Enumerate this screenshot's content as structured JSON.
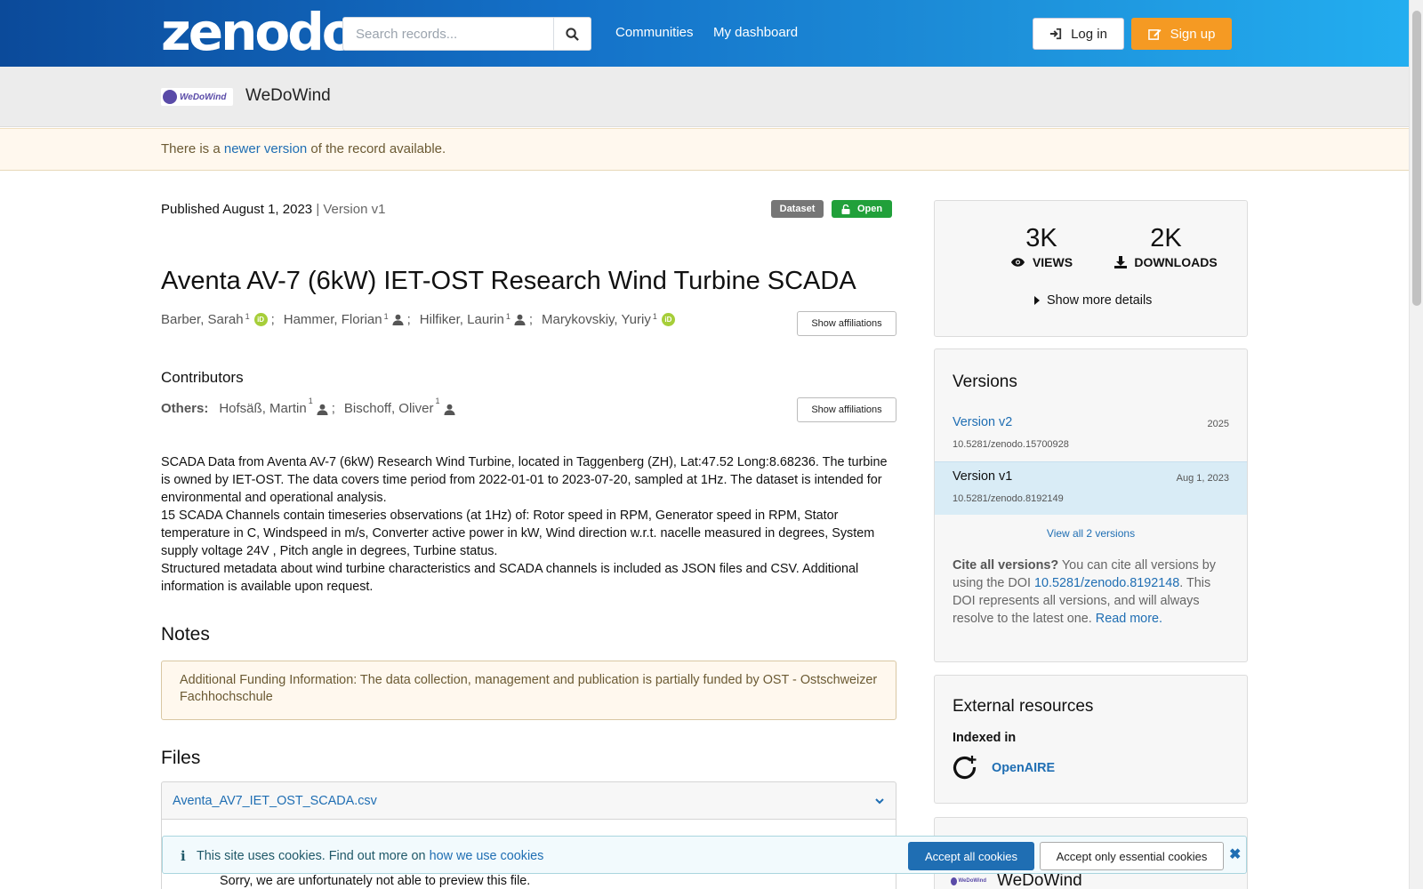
{
  "header": {
    "logo_text": "zenodo",
    "search_placeholder": "Search records...",
    "nav": [
      "Communities",
      "My dashboard"
    ],
    "login_label": "Log in",
    "signup_label": "Sign up"
  },
  "community": {
    "logo_text": "WeDoWind",
    "name": "WeDoWind"
  },
  "notice": {
    "prefix": "There is a ",
    "link": "newer version",
    "suffix": " of the record available."
  },
  "record": {
    "published_label": "Published August 1, 2023",
    "version_label": "| Version v1",
    "badge_type": "Dataset",
    "badge_access": "Open",
    "title": "Aventa AV-7 (6kW) IET-OST Research Wind Turbine SCADA",
    "creators": [
      {
        "name": "Barber, Sarah",
        "aff": "1",
        "icon": "orcid-icon"
      },
      {
        "name": "Hammer, Florian",
        "aff": "1",
        "icon": "person-icon"
      },
      {
        "name": "Hilfiker, Laurin",
        "aff": "1",
        "icon": "person-icon"
      },
      {
        "name": "Marykovskiy, Yuriy",
        "aff": "1",
        "icon": "orcid-icon"
      }
    ],
    "show_affiliations": "Show affiliations",
    "contributors_heading": "Contributors",
    "others_label": "Others:",
    "contributors": [
      {
        "name": "Hofsäß, Martin",
        "aff": "1"
      },
      {
        "name": "Bischoff, Oliver",
        "aff": "1"
      }
    ],
    "description": [
      "SCADA Data from Aventa AV-7 (6kW) Research Wind Turbine, located in Taggenberg (ZH), Lat:47.52 Long:8.68236. The turbine is owned by IET-OST. The data covers time period from 2022-01-01 to 2023-07-20, sampled at 1Hz. The dataset is intended for environmental and operational analysis.",
      "15 SCADA Channels contain timeseries observations (at 1Hz) of: Rotor speed in RPM, Generator speed in RPM, Stator temperature in C, Windspeed in m/s, Converter active power in kW, Wind direction w.r.t. nacelle measured in degrees, System supply voltage 24V , Pitch angle in degrees, Turbine status.",
      "Structured metadata about wind turbine characteristics and SCADA channels is included as JSON files and CSV. Additional information is available upon request."
    ],
    "notes_heading": "Notes",
    "notes_text": "Additional Funding Information: The data collection, management and publication is partially funded by OST - Ostschweizer Fachhochschule",
    "files_heading": "Files",
    "file_name": "Aventa_AV7_IET_OST_SCADA.csv",
    "preview_msg": "Sorry, we are unfortunately not able to preview this file."
  },
  "stats": {
    "views": "3K",
    "views_label": "VIEWS",
    "downloads": "2K",
    "downloads_label": "DOWNLOADS",
    "more_label": "Show more details"
  },
  "versions": {
    "heading": "Versions",
    "items": [
      {
        "name": "Version v2",
        "doi": "10.5281/zenodo.15700928",
        "date": "2025"
      },
      {
        "name": "Version v1",
        "doi": "10.5281/zenodo.8192149",
        "date": "Aug 1, 2023"
      }
    ],
    "view_all": "View all 2 versions",
    "cite_bold": "Cite all versions?",
    "cite_text1": " You can cite all versions by using the DOI ",
    "cite_doi": "10.5281/zenodo.8192148",
    "cite_text2": ". This DOI represents all versions, and will always resolve to the latest one. ",
    "cite_more": "Read more."
  },
  "external": {
    "heading": "External resources",
    "indexed": "Indexed in",
    "source": "OpenAIRE"
  },
  "footer_card": {
    "name": "WeDoWind"
  },
  "cookie": {
    "info_glyph": "i",
    "text": "This site uses cookies. Find out more on ",
    "link": "how we use cookies",
    "accept_all": "Accept all cookies",
    "accept_essential": "Accept only essential cookies",
    "close_glyph": "✖"
  },
  "colors": {
    "header_start": "#0b4a9a",
    "header_end": "#23aef0",
    "signup": "#f59a23",
    "link": "#1f6eb3",
    "open_badge": "#21a03a"
  }
}
